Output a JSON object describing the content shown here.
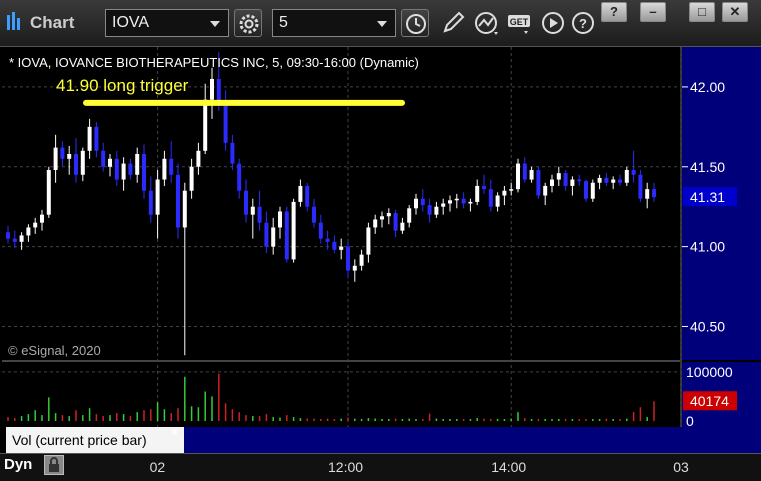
{
  "app": {
    "title": "Chart"
  },
  "toolbar": {
    "symbol": "IOVA",
    "interval": "5",
    "icons": [
      "settings-gear-icon",
      "clock-icon",
      "pencil-icon",
      "line-chart-icon",
      "get-icon",
      "play-icon",
      "help-icon"
    ],
    "window_buttons": [
      "?",
      "–",
      "□",
      "✕"
    ]
  },
  "chart_header": "* IOVA, IOVANCE BIOTHERAPEUTICS INC, 5, 09:30-16:00 (Dynamic)",
  "watermark": "© eSignal, 2020",
  "annotation": {
    "text": "41.90 long trigger",
    "price": 41.9,
    "color": "#ffff33"
  },
  "colors": {
    "up": "#ffffff",
    "down": "#2b2bff",
    "vol_up": "#33cc33",
    "vol_down": "#cc2222",
    "axis_bg": "#00007a"
  },
  "volume_panel": {
    "label": "Vol (current price bar)",
    "close_label": "×"
  },
  "status": {
    "mode": "Dyn"
  },
  "chart_data": [
    {
      "type": "candlestick",
      "title": "",
      "ylim": [
        40.29,
        42.25
      ],
      "yticks": [
        "42.00",
        "41.50",
        "41.00",
        "40.50"
      ],
      "last_price": "41.31",
      "x_tick_labels": [
        "02",
        "12:00",
        "14:00",
        "03"
      ],
      "x_tick_bars": [
        22,
        50,
        74,
        99
      ],
      "grid": true,
      "candles": [
        [
          41.09,
          41.13,
          41.02,
          41.05
        ],
        [
          41.05,
          41.1,
          40.99,
          41.03
        ],
        [
          41.03,
          41.09,
          40.98,
          41.07
        ],
        [
          41.07,
          41.14,
          41.03,
          41.12
        ],
        [
          41.12,
          41.18,
          41.08,
          41.15
        ],
        [
          41.15,
          41.23,
          41.1,
          41.2
        ],
        [
          41.2,
          41.5,
          41.18,
          41.48
        ],
        [
          41.48,
          41.7,
          41.4,
          41.62
        ],
        [
          41.62,
          41.66,
          41.5,
          41.55
        ],
        [
          41.55,
          41.63,
          41.45,
          41.58
        ],
        [
          41.58,
          41.68,
          41.4,
          41.45
        ],
        [
          41.45,
          41.62,
          41.41,
          41.6
        ],
        [
          41.6,
          41.8,
          41.55,
          41.75
        ],
        [
          41.75,
          41.78,
          41.56,
          41.6
        ],
        [
          41.6,
          41.65,
          41.47,
          41.5
        ],
        [
          41.5,
          41.58,
          41.44,
          41.55
        ],
        [
          41.55,
          41.6,
          41.38,
          41.42
        ],
        [
          41.42,
          41.56,
          41.35,
          41.52
        ],
        [
          41.52,
          41.55,
          41.42,
          41.45
        ],
        [
          41.45,
          41.62,
          41.4,
          41.58
        ],
        [
          41.58,
          41.64,
          41.3,
          41.35
        ],
        [
          41.35,
          41.44,
          41.15,
          41.2
        ],
        [
          41.2,
          41.48,
          41.05,
          41.42
        ],
        [
          41.42,
          41.6,
          41.38,
          41.55
        ],
        [
          41.55,
          41.66,
          41.4,
          41.45
        ],
        [
          41.45,
          41.52,
          41.05,
          41.12
        ],
        [
          41.12,
          41.4,
          40.32,
          41.35
        ],
        [
          41.35,
          41.55,
          41.3,
          41.5
        ],
        [
          41.5,
          41.65,
          41.45,
          41.6
        ],
        [
          41.6,
          42.02,
          41.58,
          41.92
        ],
        [
          41.92,
          42.12,
          41.8,
          42.05
        ],
        [
          42.05,
          42.22,
          41.85,
          41.9
        ],
        [
          41.9,
          41.98,
          41.6,
          41.65
        ],
        [
          41.65,
          41.7,
          41.48,
          41.52
        ],
        [
          41.52,
          41.55,
          41.3,
          41.35
        ],
        [
          41.35,
          41.42,
          41.15,
          41.2
        ],
        [
          41.2,
          41.3,
          41.05,
          41.25
        ],
        [
          41.25,
          41.35,
          41.1,
          41.15
        ],
        [
          41.15,
          41.22,
          40.96,
          41.0
        ],
        [
          41.0,
          41.18,
          40.95,
          41.12
        ],
        [
          41.12,
          41.25,
          41.05,
          41.22
        ],
        [
          41.22,
          41.25,
          40.9,
          40.92
        ],
        [
          40.92,
          41.3,
          40.9,
          41.28
        ],
        [
          41.28,
          41.42,
          41.25,
          41.38
        ],
        [
          41.38,
          41.4,
          41.22,
          41.25
        ],
        [
          41.25,
          41.3,
          41.12,
          41.15
        ],
        [
          41.15,
          41.2,
          41.02,
          41.05
        ],
        [
          41.05,
          41.1,
          40.98,
          41.03
        ],
        [
          41.03,
          41.07,
          40.96,
          40.98
        ],
        [
          40.98,
          41.05,
          40.92,
          41.0
        ],
        [
          41.0,
          41.03,
          40.8,
          40.85
        ],
        [
          40.85,
          40.92,
          40.78,
          40.88
        ],
        [
          40.88,
          40.98,
          40.85,
          40.95
        ],
        [
          40.95,
          41.15,
          40.9,
          41.12
        ],
        [
          41.12,
          41.2,
          41.08,
          41.17
        ],
        [
          41.17,
          41.22,
          41.12,
          41.19
        ],
        [
          41.19,
          41.24,
          41.14,
          41.21
        ],
        [
          41.21,
          41.23,
          41.06,
          41.1
        ],
        [
          41.1,
          41.18,
          41.08,
          41.15
        ],
        [
          41.15,
          41.26,
          41.12,
          41.24
        ],
        [
          41.24,
          41.33,
          41.2,
          41.3
        ],
        [
          41.3,
          41.36,
          41.22,
          41.26
        ],
        [
          41.26,
          41.3,
          41.15,
          41.2
        ],
        [
          41.2,
          41.28,
          41.18,
          41.25
        ],
        [
          41.25,
          41.3,
          41.2,
          41.27
        ],
        [
          41.27,
          41.32,
          41.22,
          41.29
        ],
        [
          41.29,
          41.33,
          41.24,
          41.3
        ],
        [
          41.3,
          41.34,
          41.24,
          41.27
        ],
        [
          41.27,
          41.3,
          41.22,
          41.28
        ],
        [
          41.28,
          41.42,
          41.26,
          41.38
        ],
        [
          41.38,
          41.45,
          41.33,
          41.36
        ],
        [
          41.36,
          41.42,
          41.22,
          41.25
        ],
        [
          41.25,
          41.34,
          41.22,
          41.32
        ],
        [
          41.32,
          41.38,
          41.26,
          41.35
        ],
        [
          41.35,
          41.4,
          41.32,
          41.36
        ],
        [
          41.36,
          41.55,
          41.34,
          41.52
        ],
        [
          41.52,
          41.56,
          41.4,
          41.42
        ],
        [
          41.42,
          41.5,
          41.4,
          41.48
        ],
        [
          41.48,
          41.5,
          41.3,
          41.32
        ],
        [
          41.32,
          41.4,
          41.26,
          41.38
        ],
        [
          41.38,
          41.45,
          41.34,
          41.42
        ],
        [
          41.42,
          41.5,
          41.38,
          41.46
        ],
        [
          41.46,
          41.48,
          41.35,
          41.38
        ],
        [
          41.38,
          41.44,
          41.32,
          41.42
        ],
        [
          41.42,
          41.45,
          41.38,
          41.41
        ],
        [
          41.41,
          41.42,
          41.28,
          41.3
        ],
        [
          41.3,
          41.42,
          41.28,
          41.4
        ],
        [
          41.4,
          41.45,
          41.36,
          41.43
        ],
        [
          41.43,
          41.46,
          41.38,
          41.4
        ],
        [
          41.4,
          41.44,
          41.36,
          41.42
        ],
        [
          41.42,
          41.45,
          41.38,
          41.4
        ],
        [
          41.4,
          41.5,
          41.38,
          41.48
        ],
        [
          41.48,
          41.6,
          41.4,
          41.45
        ],
        [
          41.45,
          41.48,
          41.28,
          41.3
        ],
        [
          41.3,
          41.4,
          41.24,
          41.36
        ],
        [
          41.36,
          41.4,
          41.28,
          41.31
        ]
      ],
      "volume": {
        "ylim": [
          0,
          120000
        ],
        "yticks": [
          "100000",
          "0"
        ],
        "last_volume": "40174",
        "values": [
          8000,
          6000,
          10000,
          14000,
          22000,
          12000,
          48000,
          16000,
          12000,
          10000,
          22000,
          12000,
          26000,
          14000,
          10000,
          12000,
          16000,
          14000,
          10000,
          18000,
          22000,
          24000,
          38000,
          24000,
          16000,
          26000,
          90000,
          30000,
          28000,
          60000,
          50000,
          96000,
          36000,
          24000,
          18000,
          12000,
          10000,
          10000,
          14000,
          8000,
          7000,
          12000,
          8000,
          6000,
          5000,
          5000,
          4000,
          5000,
          4000,
          5000,
          7000,
          5000,
          4000,
          6000,
          5000,
          4000,
          4000,
          5000,
          4000,
          5000,
          4000,
          4000,
          15000,
          5000,
          4000,
          4000,
          4000,
          4000,
          4000,
          6000,
          5000,
          4000,
          4000,
          4000,
          5000,
          18000,
          6000,
          4000,
          4000,
          4000,
          4000,
          4000,
          4000,
          4000,
          4000,
          4000,
          4000,
          4000,
          5000,
          4000,
          4000,
          5000,
          18000,
          28000,
          8000,
          40174
        ]
      }
    }
  ]
}
